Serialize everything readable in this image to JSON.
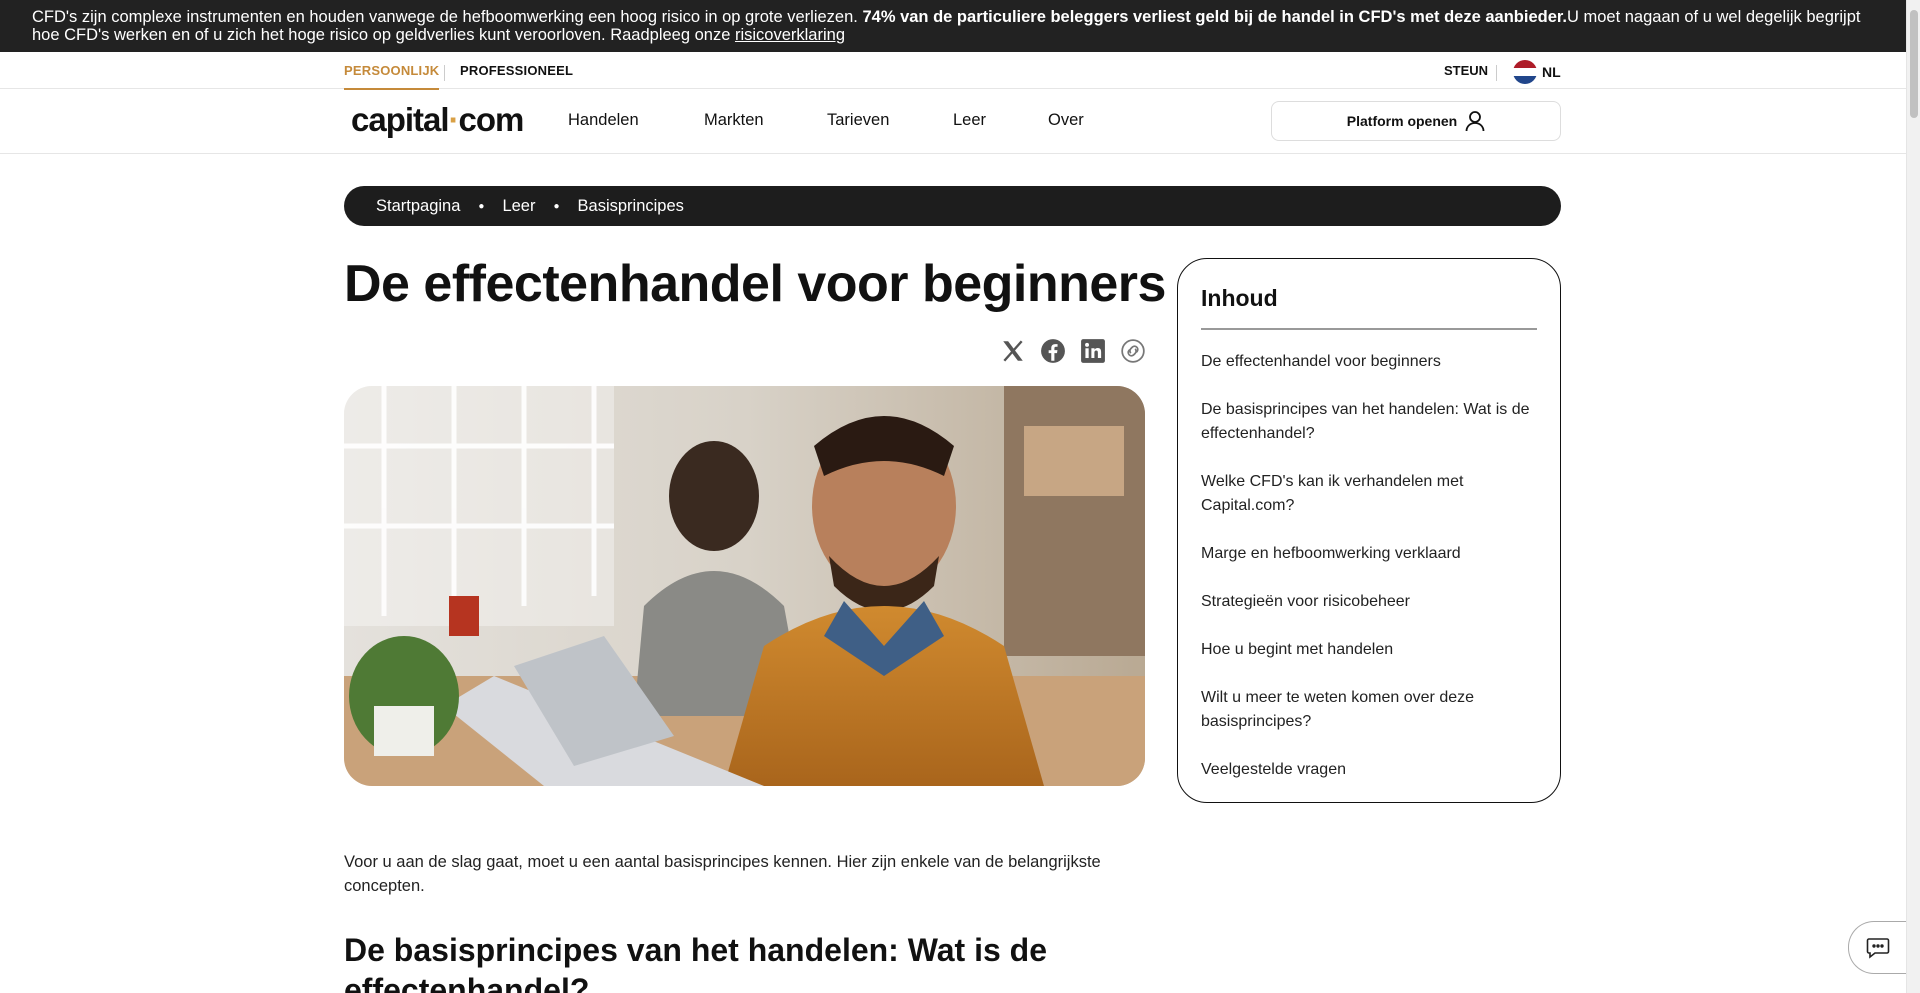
{
  "risk_banner": {
    "text_before": "CFD's zijn complexe instrumenten en houden vanwege de hefboomwerking een hoog risico in op grote verliezen. ",
    "text_bold": "74% van de particuliere beleggers verliest geld bij de handel in CFD's met deze aanbieder.",
    "text_after": "U moet nagaan of u wel degelijk begrijpt hoe CFD's werken en of u zich het hoge risico op geldverlies kunt veroorloven. Raadpleeg onze ",
    "link_text": "risicoverklaring"
  },
  "top_strip": {
    "personal": "PERSOONLIJK",
    "professional": "PROFESSIONEEL",
    "support": "STEUN",
    "language": "NL"
  },
  "nav": {
    "logo_part1": "capital",
    "logo_dot": "·",
    "logo_part2": "com",
    "items": [
      "Handelen",
      "Markten",
      "Tarieven",
      "Leer",
      "Over"
    ],
    "platform_button": "Platform openen"
  },
  "breadcrumb": [
    "Startpagina",
    "Leer",
    "Basisprincipes"
  ],
  "article": {
    "title": "De effectenhandel voor beginners",
    "intro": "Voor u aan de slag gaat, moet u een aantal basisprincipes kennen. Hier zijn enkele van de belangrijkste concepten.",
    "section_heading": "De basisprincipes van het handelen: Wat is de effectenhandel?"
  },
  "share_icons": [
    "x-icon",
    "facebook-icon",
    "linkedin-icon",
    "copy-link-icon"
  ],
  "toc": {
    "title": "Inhoud",
    "items": [
      "De effectenhandel voor beginners",
      "De basisprincipes van het handelen: Wat is de effectenhandel?",
      "Welke CFD's kan ik verhandelen met Capital.com?",
      "Marge en hefboomwerking verklaard",
      "Strategieën voor risicobeheer",
      "Hoe u begint met handelen",
      "Wilt u meer te weten komen over deze basisprincipes?",
      "Veelgestelde vragen"
    ]
  },
  "colors": {
    "accent": "#c58a3a",
    "dark": "#1d1d1d",
    "flag_red": "#ae1c28",
    "flag_white": "#ffffff",
    "flag_blue": "#21468b"
  }
}
